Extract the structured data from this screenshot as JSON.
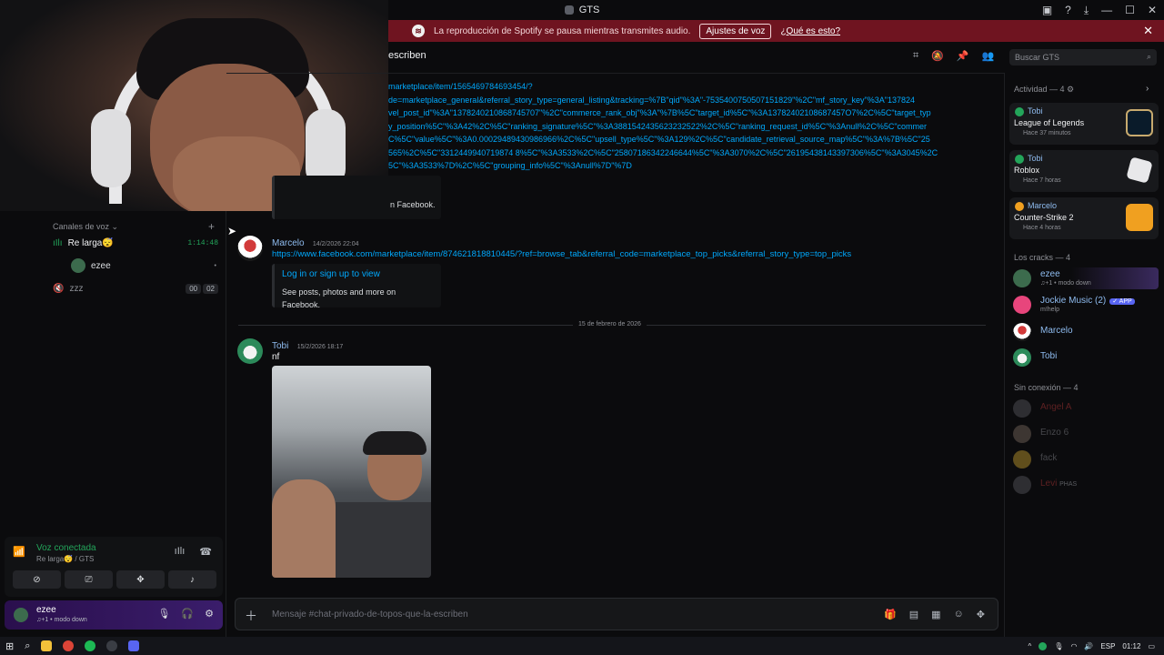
{
  "window": {
    "title": "GTS",
    "icons": [
      "notification-icon",
      "help-icon",
      "download-icon",
      "minimize-icon",
      "maximize-icon",
      "close-icon"
    ]
  },
  "banner": {
    "text": "La reproducción de Spotify se pausa mientras transmites audio.",
    "button": "Ajustes de voz",
    "link": "¿Qué es esto?"
  },
  "sidebar": {
    "voice_header": "Canales de voz",
    "channels": [
      {
        "name": "Re larga😴",
        "time": "1:14:48"
      },
      {
        "name": "zzz",
        "count_a": "00",
        "count_b": "02"
      }
    ],
    "voice_user": "ezee"
  },
  "voice_panel": {
    "status": "Voz conectada",
    "sub": "Re larga😴 / GTS"
  },
  "user_panel": {
    "name": "ezee",
    "status": "♫+1 •   modo down"
  },
  "channel": {
    "title": "escriben",
    "search_placeholder": "Buscar GTS",
    "composer_placeholder": "Mensaje #chat-privado-de-topos-que-la-escriben"
  },
  "messages": {
    "link1_lines": [
      "marketplace/item/1565469784693454/?",
      "de=marketplace_general&referral_story_type=general_listing&tracking=%7B\"qid\"%3A\"-7535400750507151829\"%2C\"mf_story_key\"%3A\"137824",
      "vel_post_id\"%3A\"1378240210868745707\"%2C\"commerce_rank_obj\"%3A\"%7B%5C\"target_id%5C\"%3A13782402108687457O7%2C%5C\"target_typ",
      "y_position%5C\"%3A42%2C%5C\"ranking_signature%5C\"%3A3881542435623232522%2C%5C\"ranking_request_id%5C\"%3Anull%2C%5C\"commer",
      "C%5C\"value%5C\"%3A0.00029489430986966%2C%5C\"upsell_type%5C\"%3A129%2C%5C\"candidate_retrieval_source_map%5C\"%3A%7B%5C\"25",
      "565%2C%5C\"3312449940719874 8%5C\"%3A3533%2C%5C\"25807186342246644%5C\"%3A3070%2C%5C\"26195438143397306%5C\"%3A3045%2C",
      "5C\"%3A3533%7D%2C%5C\"grouping_info%5C\"%3Anull%7D\"%7D"
    ],
    "embed0_text": "n Facebook.",
    "marcelo": {
      "author": "Marcelo",
      "time": "14/2/2026 22:04",
      "link": "https://www.facebook.com/marketplace/item/874621818810445/?ref=browse_tab&referral_code=marketplace_top_picks&referral_story_type=top_picks",
      "embed_title": "Log in or sign up to view",
      "embed_desc": "See posts, photos and more on Facebook."
    },
    "date_divider": "15 de febrero de 2026",
    "tobi": {
      "author": "Tobi",
      "time": "15/2/2026 18:17",
      "text": "nf"
    }
  },
  "rightbar": {
    "activity_header": "Actividad — 4",
    "activities": [
      {
        "user": "Tobi",
        "game": "League of Legends",
        "ago": "Hace 37 minutos",
        "color": "#c8aa6e"
      },
      {
        "user": "Tobi",
        "game": "Roblox",
        "ago": "Hace 7 horas",
        "color": "#d0d0d0"
      },
      {
        "user": "Marcelo",
        "game": "Counter-Strike 2",
        "ago": "Hace 4 horas",
        "color": "#f0a020"
      }
    ],
    "online_header": "Los cracks — 4",
    "online": [
      {
        "name": "ezee",
        "status": "♫+1 •   modo down",
        "color": "#8fbcf0"
      },
      {
        "name": "Jockie Music (2)",
        "status": "m!help",
        "badge": "✓ APP",
        "color": "#8fbcf0"
      },
      {
        "name": "Marcelo",
        "status": "",
        "color": "#8fbcf0"
      },
      {
        "name": "Tobi",
        "status": "",
        "color": "#8fbcf0"
      }
    ],
    "offline_header": "Sin conexión — 4",
    "offline": [
      {
        "name": "Angel A",
        "color": "#7a2a2a"
      },
      {
        "name": "Enzo 6",
        "color": "#555a64"
      },
      {
        "name": "fack",
        "color": "#555a64"
      },
      {
        "name": "Levi",
        "badge": "PHAS",
        "color": "#7a2a2a"
      }
    ]
  },
  "taskbar": {
    "lang": "ESP",
    "clock": "01:12"
  }
}
